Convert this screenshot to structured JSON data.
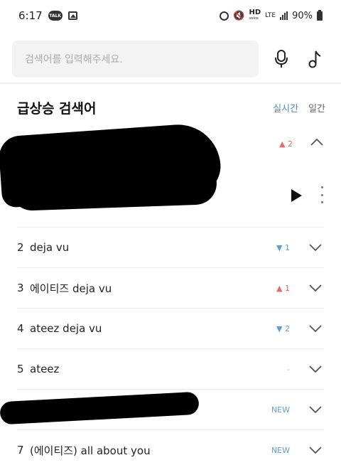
{
  "status_bar": {
    "time": "6:17",
    "talk_badge": "TALK",
    "hd": "HD",
    "voice": "voice",
    "lte": "LTE",
    "battery": "90%"
  },
  "search": {
    "placeholder": "검색어를 입력해주세요."
  },
  "section": {
    "title": "급상승 검색어",
    "tab_realtime": "실시간",
    "tab_daily": "일간"
  },
  "expanded_item": {
    "change": "▲ 2"
  },
  "rank_list": [
    {
      "num": "2",
      "keyword": "deja vu",
      "change": "▼ 1",
      "trend": "down"
    },
    {
      "num": "3",
      "keyword": "에이티즈 deja vu",
      "change": "▲ 1",
      "trend": "up"
    },
    {
      "num": "4",
      "keyword": "ateez deja vu",
      "change": "▼ 2",
      "trend": "down"
    },
    {
      "num": "5",
      "keyword": "ateez",
      "change": "-",
      "trend": "same"
    },
    {
      "num": "",
      "keyword": "",
      "change": "NEW",
      "trend": "new"
    },
    {
      "num": "7",
      "keyword": "(에이티즈) all about you",
      "change": "NEW",
      "trend": "new"
    }
  ],
  "colors": {
    "accent": "#3d8fd6",
    "up": "#e26b6b",
    "down": "#5b9ed8"
  }
}
